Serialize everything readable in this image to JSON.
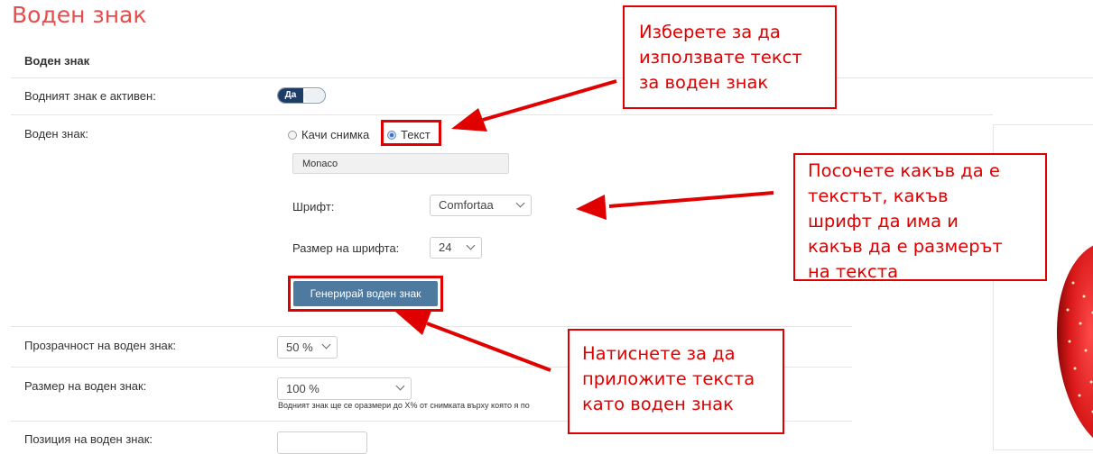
{
  "header": {
    "title": "Воден знак"
  },
  "section": {
    "title": "Воден знак"
  },
  "rows": {
    "active": {
      "label": "Водният знак е активен:",
      "toggle_value": "Да"
    },
    "watermark": {
      "label": "Воден знак:",
      "radio_upload": "Качи снимка",
      "radio_text": "Текст",
      "text_value": "Monaco",
      "font_label": "Шрифт:",
      "font_value": "Comfortaa",
      "font_size_label": "Размер на шрифта:",
      "font_size_value": "24",
      "generate_button": "Генерирай воден знак"
    },
    "opacity": {
      "label": "Прозрачност на воден знак:",
      "value": "50 %"
    },
    "size": {
      "label": "Размер на воден знак:",
      "value": "100 %",
      "hint": "Водният знак ще се оразмери до X% от снимката върху която я по"
    },
    "position": {
      "label": "Позиция на воден знак:"
    }
  },
  "annotations": {
    "callout_text_choice": [
      "Изберете за да",
      "използвате текст",
      "за воден знак"
    ],
    "callout_font": [
      "Посочете какъв да е",
      "текстът, какъв",
      "шрифт да има и",
      "какъв да е размерът",
      "на текста"
    ],
    "callout_apply": [
      "Натиснете за да",
      "приложите текста",
      "като воден знак"
    ],
    "color": "#e00000"
  }
}
